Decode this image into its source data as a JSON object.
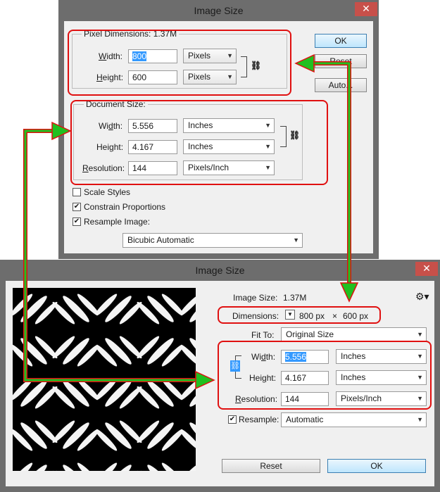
{
  "old_dialog": {
    "title": "Image Size",
    "close": "✕",
    "pixel_dimensions": {
      "legend": "Pixel Dimensions:",
      "size": "1.37M"
    },
    "width": {
      "label": "Width:",
      "value": "800",
      "unit": "Pixels"
    },
    "height": {
      "label": "Height:",
      "value": "600",
      "unit": "Pixels"
    },
    "buttons": {
      "ok": "OK",
      "reset": "Reset",
      "auto": "Auto..."
    },
    "document_size": {
      "legend": "Document Size:",
      "width": {
        "label": "Width:",
        "value": "5.556",
        "unit": "Inches"
      },
      "height": {
        "label": "Height:",
        "value": "4.167",
        "unit": "Inches"
      },
      "resolution": {
        "label": "Resolution:",
        "value": "144",
        "unit": "Pixels/Inch"
      }
    },
    "checkboxes": {
      "scale_styles": {
        "label": "Scale Styles",
        "checked": false
      },
      "constrain": {
        "label": "Constrain Proportions",
        "checked": true
      },
      "resample": {
        "label": "Resample Image:",
        "checked": true
      }
    },
    "resample_method": "Bicubic Automatic"
  },
  "new_dialog": {
    "title": "Image Size",
    "close": "✕",
    "image_size": {
      "label": "Image Size:",
      "value": "1.37M"
    },
    "dimensions": {
      "label": "Dimensions:",
      "width": "800 px",
      "times": "×",
      "height": "600 px"
    },
    "fit_to": {
      "label": "Fit To:",
      "value": "Original Size"
    },
    "width": {
      "label": "Width:",
      "value": "5.556",
      "unit": "Inches"
    },
    "height": {
      "label": "Height:",
      "value": "4.167",
      "unit": "Inches"
    },
    "resolution": {
      "label": "Resolution:",
      "value": "144",
      "unit": "Pixels/Inch"
    },
    "resample": {
      "label": "Resample:",
      "value": "Automatic",
      "checked": true
    },
    "buttons": {
      "reset": "Reset",
      "ok": "OK"
    }
  },
  "colors": {
    "highlight": "#e01010",
    "arrow": "#20c020",
    "titlebar": "#6d6d6d",
    "close": "#c7504a"
  },
  "icons": {
    "link": "chain-link-icon",
    "gear": "gear-icon",
    "dropdown": "chevron-down-icon"
  }
}
